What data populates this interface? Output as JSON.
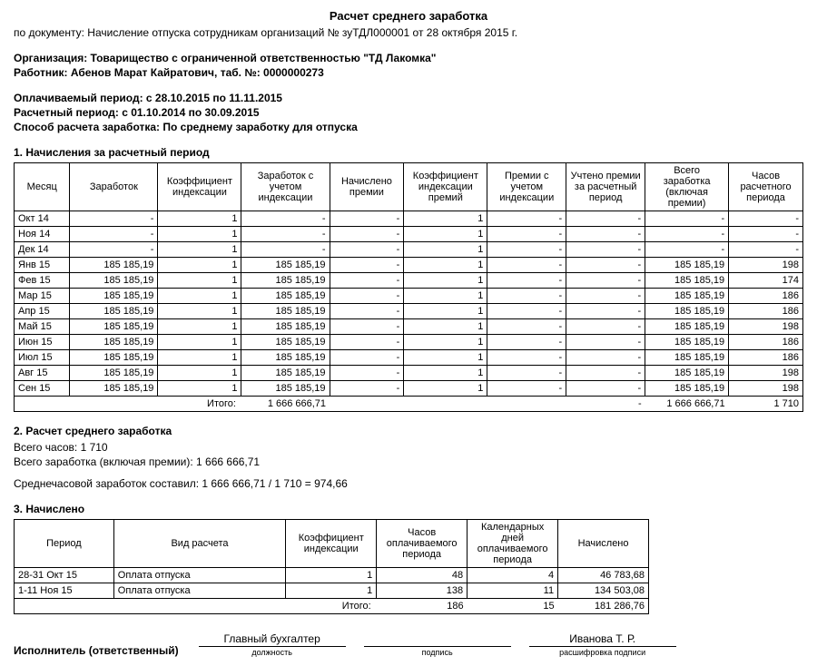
{
  "title": "Расчет среднего заработка",
  "doc_prefix": "по документу: ",
  "doc_text": "Начисление отпуска сотрудникам организаций № зуТДЛ000001 от 28 октября 2015 г.",
  "org_label": "Организация: ",
  "org_value": "Товарищество с ограниченной ответственностью \"ТД Лакомка\"",
  "emp_label": "Работник: ",
  "emp_value": "Абенов Марат Кайратович, таб. №: 0000000273",
  "paid_period_label": "Оплачиваемый период: ",
  "paid_period_value": "с 28.10.2015 по 11.11.2015",
  "calc_period_label": "Расчетный период: ",
  "calc_period_value": "с 01.10.2014 по 30.09.2015",
  "method_label": "Способ расчета заработка: ",
  "method_value": "По среднему заработку для отпуска",
  "section1_title": "1. Начисления за расчетный период",
  "t1": {
    "headers": {
      "c1": "Месяц",
      "c2": "Заработок",
      "c3": "Коэффициент индексации",
      "c4": "Заработок с учетом индексации",
      "c5": "Начислено премии",
      "c6": "Коэффициент индексации премий",
      "c7": "Премии с учетом индексации",
      "c8": "Учтено премии за расчетный период",
      "c9": "Всего заработка (включая премии)",
      "c10": "Часов расчетного периода"
    },
    "rows": [
      {
        "m": "Окт 14",
        "z": "-",
        "ki": "1",
        "zi": "-",
        "np": "-",
        "kip": "1",
        "pi": "-",
        "up": "-",
        "total": "-",
        "hours": "-"
      },
      {
        "m": "Ноя 14",
        "z": "-",
        "ki": "1",
        "zi": "-",
        "np": "-",
        "kip": "1",
        "pi": "-",
        "up": "-",
        "total": "-",
        "hours": "-"
      },
      {
        "m": "Дек 14",
        "z": "-",
        "ki": "1",
        "zi": "-",
        "np": "-",
        "kip": "1",
        "pi": "-",
        "up": "-",
        "total": "-",
        "hours": "-"
      },
      {
        "m": "Янв 15",
        "z": "185 185,19",
        "ki": "1",
        "zi": "185 185,19",
        "np": "-",
        "kip": "1",
        "pi": "-",
        "up": "-",
        "total": "185 185,19",
        "hours": "198"
      },
      {
        "m": "Фев 15",
        "z": "185 185,19",
        "ki": "1",
        "zi": "185 185,19",
        "np": "-",
        "kip": "1",
        "pi": "-",
        "up": "-",
        "total": "185 185,19",
        "hours": "174"
      },
      {
        "m": "Мар 15",
        "z": "185 185,19",
        "ki": "1",
        "zi": "185 185,19",
        "np": "-",
        "kip": "1",
        "pi": "-",
        "up": "-",
        "total": "185 185,19",
        "hours": "186"
      },
      {
        "m": "Апр 15",
        "z": "185 185,19",
        "ki": "1",
        "zi": "185 185,19",
        "np": "-",
        "kip": "1",
        "pi": "-",
        "up": "-",
        "total": "185 185,19",
        "hours": "186"
      },
      {
        "m": "Май 15",
        "z": "185 185,19",
        "ki": "1",
        "zi": "185 185,19",
        "np": "-",
        "kip": "1",
        "pi": "-",
        "up": "-",
        "total": "185 185,19",
        "hours": "198"
      },
      {
        "m": "Июн 15",
        "z": "185 185,19",
        "ki": "1",
        "zi": "185 185,19",
        "np": "-",
        "kip": "1",
        "pi": "-",
        "up": "-",
        "total": "185 185,19",
        "hours": "186"
      },
      {
        "m": "Июл 15",
        "z": "185 185,19",
        "ki": "1",
        "zi": "185 185,19",
        "np": "-",
        "kip": "1",
        "pi": "-",
        "up": "-",
        "total": "185 185,19",
        "hours": "186"
      },
      {
        "m": "Авг 15",
        "z": "185 185,19",
        "ki": "1",
        "zi": "185 185,19",
        "np": "-",
        "kip": "1",
        "pi": "-",
        "up": "-",
        "total": "185 185,19",
        "hours": "198"
      },
      {
        "m": "Сен 15",
        "z": "185 185,19",
        "ki": "1",
        "zi": "185 185,19",
        "np": "-",
        "kip": "1",
        "pi": "-",
        "up": "-",
        "total": "185 185,19",
        "hours": "198"
      }
    ],
    "totals_label": "Итого:",
    "totals": {
      "zi": "1 666 666,71",
      "up": "-",
      "total": "1 666 666,71",
      "hours": "1 710"
    }
  },
  "section2_title": "2. Расчет среднего  заработка",
  "calc": {
    "hours_line": "Всего часов: 1 710",
    "total_line": "Всего заработка (включая премии): 1 666 666,71",
    "avg_line": "Среднечасовой заработок составил: 1 666 666,71 / 1 710 = 974,66"
  },
  "section3_title": "3. Начислено",
  "t2": {
    "headers": {
      "c1": "Период",
      "c2": "Вид расчета",
      "c3": "Коэффициент индексации",
      "c4": "Часов оплачиваемого периода",
      "c5": "Календарных дней оплачиваемого периода",
      "c6": "Начислено"
    },
    "rows": [
      {
        "p": "28-31 Окт 15",
        "v": "Оплата отпуска",
        "k": "1",
        "h": "48",
        "d": "4",
        "n": "46 783,68"
      },
      {
        "p": "1-11 Ноя 15",
        "v": "Оплата отпуска",
        "k": "1",
        "h": "138",
        "d": "11",
        "n": "134 503,08"
      }
    ],
    "totals_label": "Итого:",
    "totals": {
      "h": "186",
      "d": "15",
      "n": "181 286,76"
    }
  },
  "sign": {
    "label": "Исполнитель (ответственный)",
    "position": "Главный бухгалтер",
    "position_caption": "должность",
    "sign_caption": "подпись",
    "name": "Иванова Т. Р.",
    "name_caption": "расшифровка подписи"
  }
}
